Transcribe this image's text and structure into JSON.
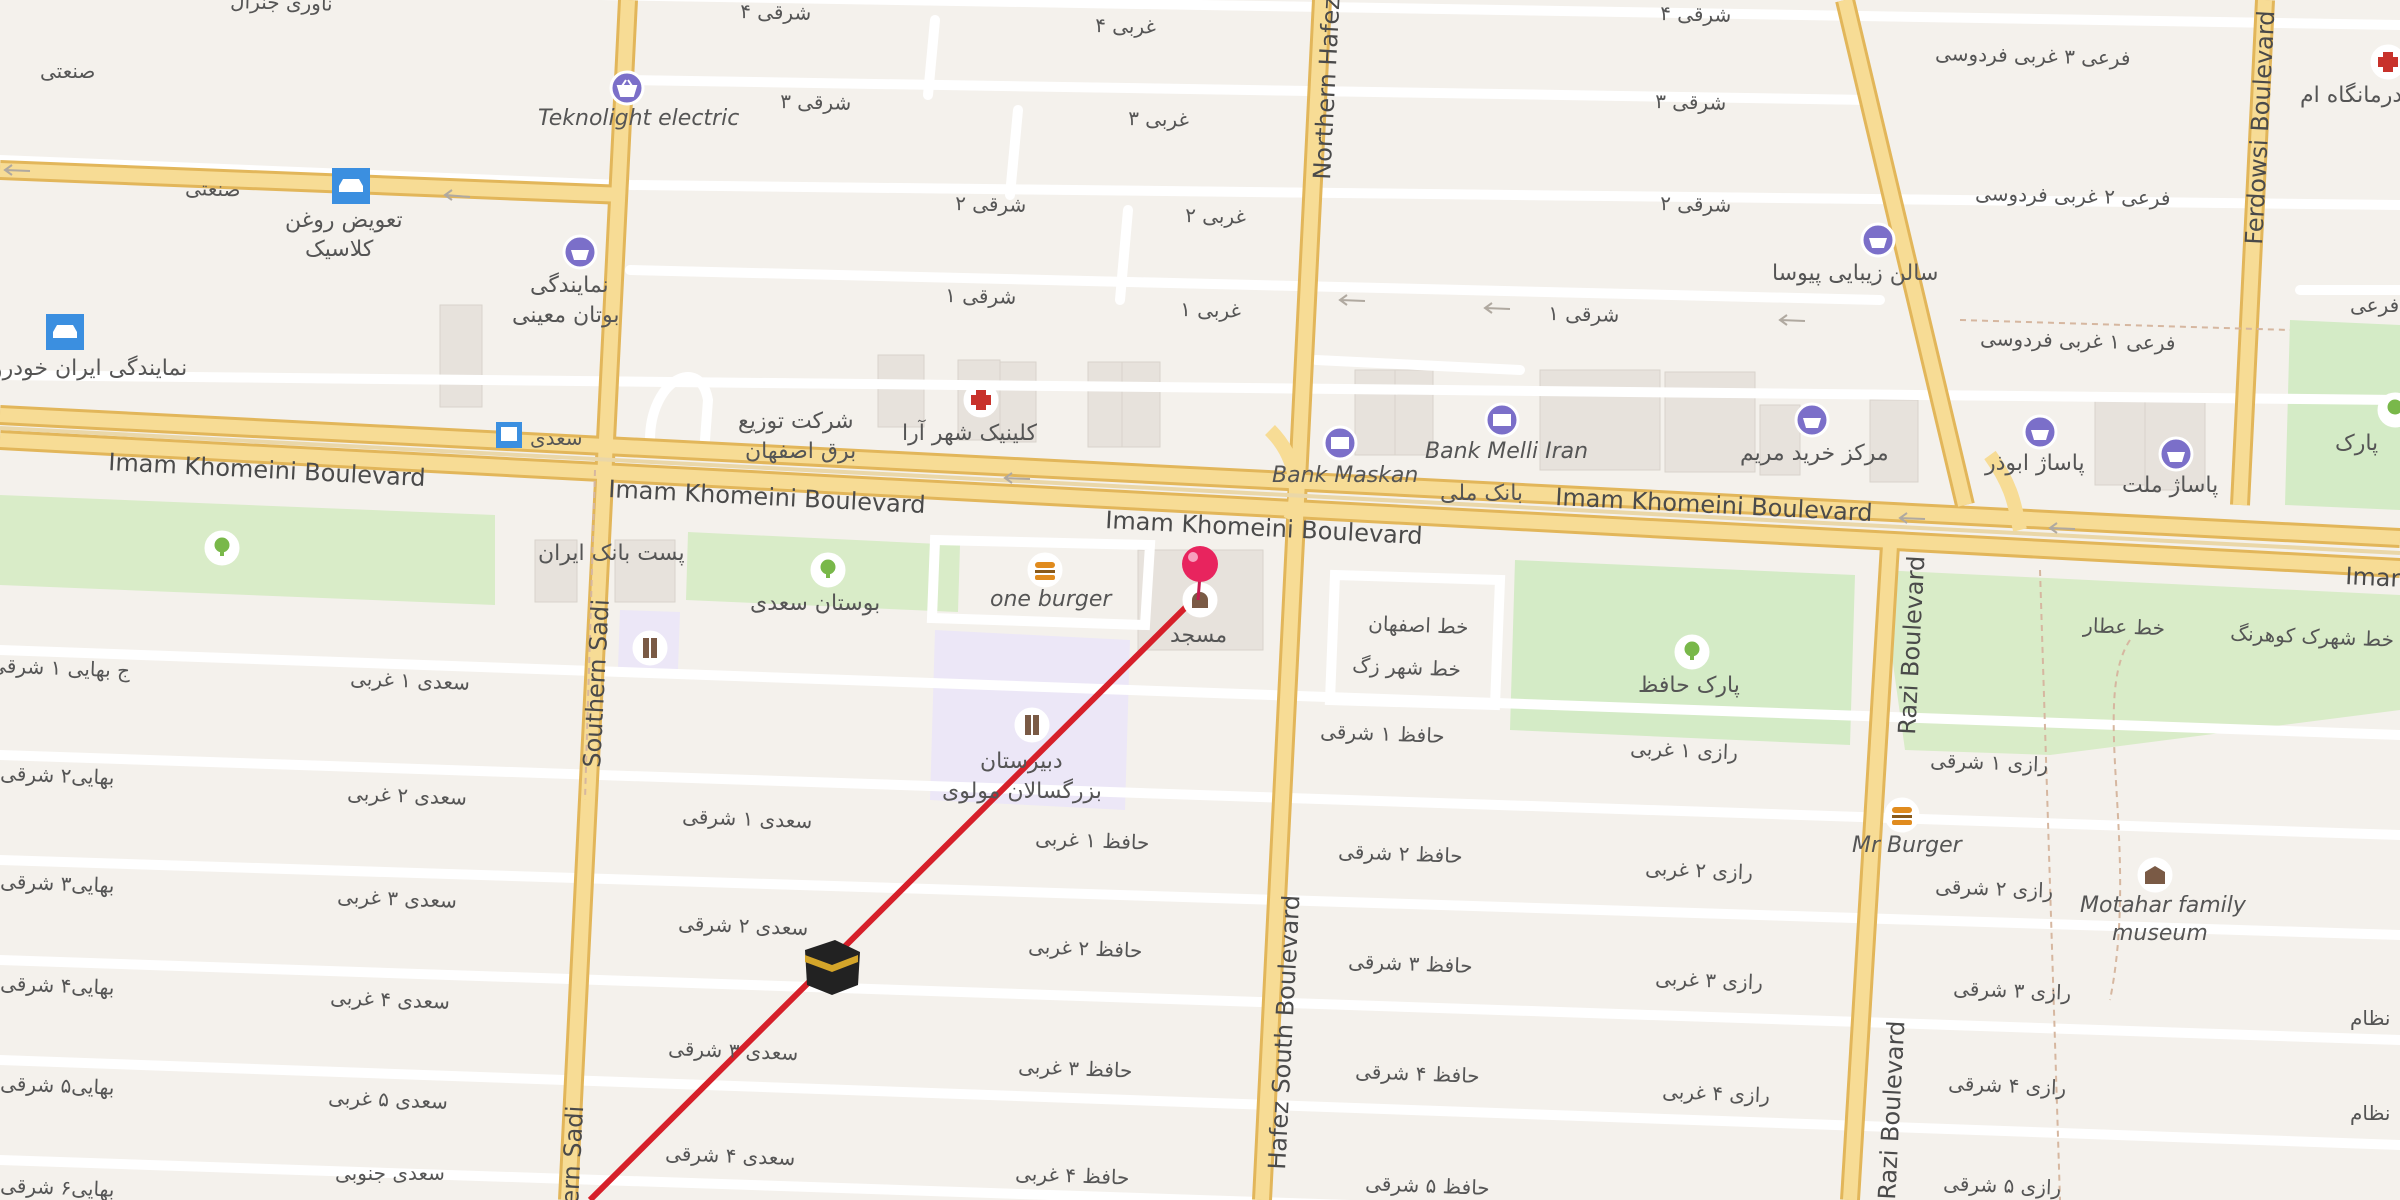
{
  "map": {
    "boulevards": {
      "imam_khomeini_1": "Imam Khomeini Boulevard",
      "imam_khomeini_2": "Imam Khomeini Boulevard",
      "imam_khomeini_3": "Imam Khomeini Boulevard",
      "imam_khomeini_4": "Imam Khomeini Boulevard",
      "imam_khomeini_5": "Iman",
      "northern_hafez": "Northern Hafez",
      "hafez_south": "Hafez South Boulevard",
      "southern_sadi": "Southern Sadi",
      "southern_sadi_2": "ern Sadi",
      "razi_1": "Razi Boulevard",
      "razi_2": "Razi Boulevard",
      "ferdowsi": "Ferdowsi Boulevard"
    },
    "streets": {
      "s4_east_top_left": "۴ شرقی",
      "s4_west_top": "۴ غربی",
      "s4_east_top_right": "۴ شرقی",
      "s3_east_top": "۳ شرقی",
      "s3_west_top": "۳ غربی",
      "s3_east_right": "۳ شرقی",
      "s2_east_top": "۲ شرقی",
      "s2_west_top": "۲ غربی",
      "s2_east_right": "۲ شرقی",
      "s1_east_top": "۱ شرقی",
      "s1_west_top": "۱ غربی",
      "s1_east_right": "۱ شرقی",
      "ferdowsi_3": "فرعی ۳ غربی فردوسی",
      "ferdowsi_2": "فرعی ۲ غربی فردوسی",
      "ferdowsi_1": "فرعی ۱ غربی فردوسی",
      "farei_edge": "فرعی",
      "sanati_1": "صنعتی",
      "sanati_2": "صنعتی",
      "top_left_cut": "ناوری جنرال",
      "bahai_1": "ج بهایی ۱ شرقی",
      "bahai_2": "بهایی۲ شرقی",
      "bahai_3": "بهایی۳ شرقی",
      "bahai_4": "بهایی۴ شرقی",
      "bahai_5": "بهایی۵ شرقی",
      "bahai_6": "بهایی۶ شرقی",
      "saadi_w1": "سعدی ۱ غربی",
      "saadi_w2": "سعدی ۲ غربی",
      "saadi_w3": "سعدی ۳ غربی",
      "saadi_w4": "سعدی ۴ غربی",
      "saadi_w5": "سعدی ۵ غربی",
      "saadi_south": "سعدی جنوبی",
      "saadi_e1": "سعدی ۱ شرقی",
      "saadi_e2": "سعدی ۲ شرقی",
      "saadi_e3": "سعدی ۳ شرقی",
      "saadi_e4": "سعدی ۴ شرقی",
      "hafez_w1": "حافظ ۱ غربی",
      "hafez_w2": "حافظ ۲ غربی",
      "hafez_w3": "حافظ ۳ غربی",
      "hafez_w4": "حافظ ۴ غربی",
      "hafez_e1": "حافظ ۱ شرقی",
      "hafez_e2": "حافظ ۲ شرقی",
      "hafez_e3": "حافظ ۳ شرقی",
      "hafez_e4": "حافظ ۴ شرقی",
      "hafez_e5": "حافظ ۵ شرقی",
      "razi_w1": "رازی ۱ غربی",
      "razi_w2": "رازی ۲ غربی",
      "razi_w3": "رازی ۳ غربی",
      "razi_w4": "رازی ۴ غربی",
      "razi_e1": "رازی ۱ شرقی",
      "razi_e2": "رازی ۲ شرقی",
      "razi_e3": "رازی ۳ شرقی",
      "razi_e4": "رازی ۴ شرقی",
      "razi_e5": "رازی ۵ شرقی",
      "nezam_1": "نظام",
      "nezam_2": "نظام",
      "khat_attar": "خط عطار",
      "khat_kohrang": "خط شهرک کوهرنگ",
      "khat_isfahan": "خط اصفهان",
      "khat_shahr": "خط شهر زگ",
      "saadi_bus": "سعدی"
    },
    "pois": {
      "teknolight": "Teknolight electric",
      "oil_change": "تعویض روغن",
      "oil_change_2": "کلاسیک",
      "dealer_1": "نمایندگی",
      "dealer_2": "بوتان معینی",
      "iran_khodro": "نمایندگی ایران خودرو",
      "sherkat_1": "شرکت توزیع",
      "sherkat_2": "برق اصفهان",
      "clinic": "کلینیک شهر آرا",
      "bank_maskan": "Bank Maskan",
      "bank_melli": "Bank Melli Iran",
      "bank_melli_fa": "بانک ملی",
      "maryam_center": "مرکز خرید مریم",
      "salon_beauty": "سالن زیبایی پیوسا",
      "pasaj_abuzar": "پاساژ ابوذر",
      "pasaj_mellat": "پاساژ ملت",
      "clinic_right": "درمانگاه ام",
      "park_right": "پارک",
      "post_bank": "پست بانک ایران",
      "saadi_garden": "بوستان سعدی",
      "one_burger": "one burger",
      "mosque": "مسجد",
      "school_1": "دبیرستان",
      "school_2": "بزرگسالان مولوی",
      "hafez_park": "پارک حافظ",
      "mr_burger": "Mr Burger",
      "motahar_1": "Motahar family",
      "motahar_2": "museum"
    },
    "colors": {
      "background": "#f4f1ec",
      "major_road": "#f6d98a",
      "road_casing": "#e3b95a",
      "park": "#d7ecc9",
      "school_zone": "#ece8f5",
      "qibla_line": "#d6202a",
      "pin": "#e8245e",
      "poi_purple": "#7b6fc9",
      "poi_blue": "#3b8fe0",
      "poi_green": "#79b84a",
      "poi_orange": "#e08b1e",
      "poi_red": "#c8322b"
    },
    "icons": [
      "shopping-basket-icon",
      "car-icon",
      "bus-icon",
      "hospital-cross-icon",
      "bank-icon",
      "tree-icon",
      "burger-icon",
      "mosque-icon",
      "school-icon",
      "museum-icon",
      "kaaba-icon",
      "location-pin-icon",
      "one-way-arrow-icon"
    ]
  }
}
